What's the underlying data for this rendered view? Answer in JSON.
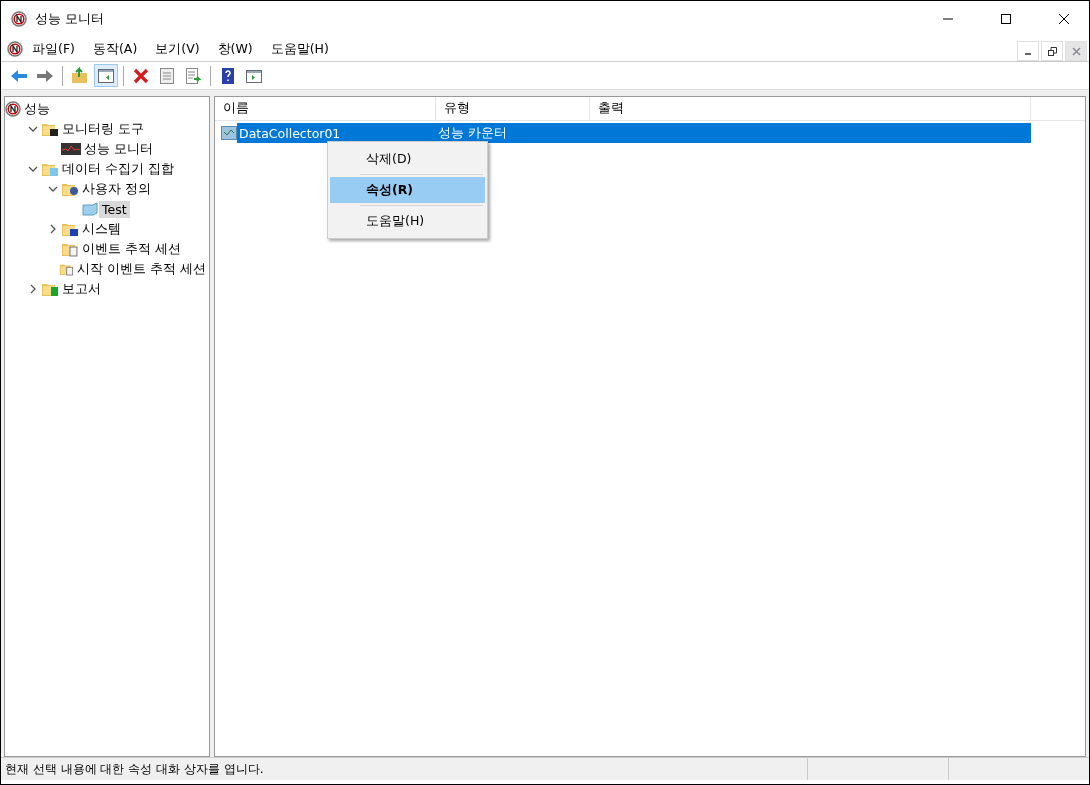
{
  "window": {
    "title": "성능 모니터"
  },
  "menu_bar": [
    "파일(F)",
    "동작(A)",
    "보기(V)",
    "창(W)",
    "도움말(H)"
  ],
  "toolbar": [
    {
      "kind": "back",
      "pressed": false
    },
    {
      "kind": "forward",
      "pressed": false
    },
    {
      "kind": "separator"
    },
    {
      "kind": "up",
      "pressed": false
    },
    {
      "kind": "pane",
      "pressed": true
    },
    {
      "kind": "separator"
    },
    {
      "kind": "delete",
      "pressed": false
    },
    {
      "kind": "properties",
      "pressed": false
    },
    {
      "kind": "export",
      "pressed": false
    },
    {
      "kind": "separator"
    },
    {
      "kind": "help",
      "pressed": false
    },
    {
      "kind": "view",
      "pressed": false
    }
  ],
  "tree": [
    {
      "label": "성능",
      "kind": "root",
      "selected": false,
      "children": [
        {
          "label": "모니터링 도구",
          "kind": "folder-monitor",
          "expanded": true,
          "selected": false,
          "children": [
            {
              "label": "성능 모니터",
              "kind": "graph",
              "selected": false
            }
          ]
        },
        {
          "label": "데이터 수집기 집합",
          "kind": "folder-data",
          "expanded": true,
          "selected": false,
          "children": [
            {
              "label": "사용자 정의",
              "kind": "folder-user",
              "expanded": true,
              "selected": false,
              "children": [
                {
                  "label": "Test",
                  "kind": "set",
                  "selected": true
                }
              ]
            },
            {
              "label": "시스템",
              "kind": "folder-system",
              "expanded": false,
              "selected": false
            },
            {
              "label": "이벤트 추적 세션",
              "kind": "folder-trace",
              "selected": false
            },
            {
              "label": "시작 이벤트 추적 세션",
              "kind": "folder-trace",
              "selected": false
            }
          ]
        },
        {
          "label": "보고서",
          "kind": "folder-report",
          "expanded": false,
          "selected": false
        }
      ]
    }
  ],
  "table": {
    "columns": [
      "이름",
      "유형",
      "출력"
    ],
    "rows": [
      {
        "cells": [
          "DataCollector01",
          "성능 카운터",
          ""
        ],
        "selected": true
      }
    ]
  },
  "context_menu": [
    {
      "label": "삭제(D)",
      "selected": false,
      "default": false
    },
    {
      "label": "속성(R)",
      "selected": true,
      "default": true
    },
    {
      "label": "도움말(H)",
      "selected": false,
      "default": false
    }
  ],
  "status_bar": "현재 선택 내용에 대한 속성 대화 상자를 엽니다."
}
